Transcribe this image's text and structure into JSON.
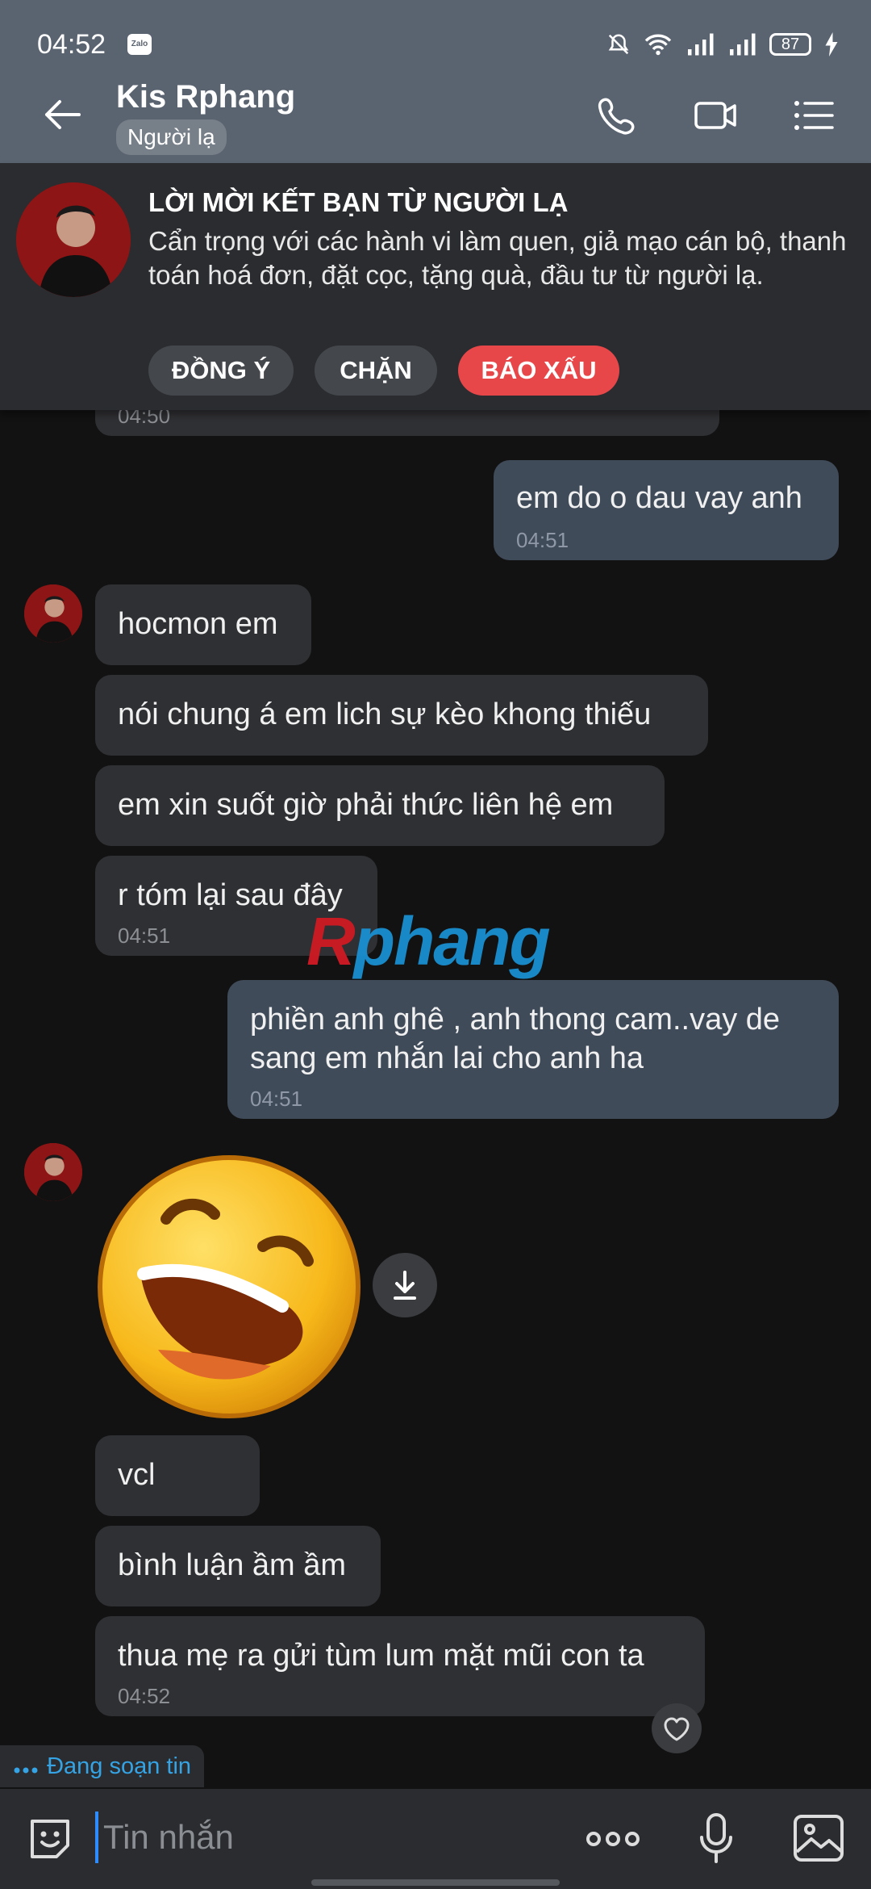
{
  "status": {
    "time": "04:52",
    "app_badge": "Zalo",
    "battery": "87"
  },
  "header": {
    "name": "Kis Rphang",
    "tag": "Người lạ"
  },
  "request": {
    "title": "LỜI MỜI KẾT BẠN TỪ NGƯỜI LẠ",
    "body": "Cẩn trọng với các hành vi làm quen, giả mạo cán bộ, thanh toán hoá đơn, đặt cọc, tặng quà, đầu tư từ người lạ.",
    "accept": "ĐỒNG Ý",
    "block": "CHẶN",
    "report": "BÁO XẤU"
  },
  "messages": {
    "m0_time": "04:50",
    "m1": {
      "text": "em do o dau vay anh",
      "time": "04:51"
    },
    "m2": "hocmon em",
    "m3": "nói chung á em lich sự kèo khong thiếu",
    "m4": "em xin suốt giờ phải thức liên hệ em",
    "m5": {
      "text": "r tóm lại sau đây",
      "time": "04:51"
    },
    "m6": {
      "line1": "phiền anh ghê , anh thong cam..vay de",
      "line2": "sang em nhắn lai cho anh ha",
      "time": "04:51"
    },
    "m7": "vcl",
    "m8": "bình luận ầm ầm",
    "m9": {
      "text": "thua mẹ ra gửi tùm lum mặt mũi con ta",
      "time": "04:52"
    }
  },
  "watermark": {
    "first": "R",
    "rest": "phang"
  },
  "typing": "Đang soạn tin",
  "input": {
    "placeholder": "Tin nhắn"
  },
  "colors": {
    "header": "#5a6370",
    "sent_bubble": "#404b5a",
    "received_bubble": "#2f3033",
    "report": "#e8474a",
    "accent": "#35a3e4"
  }
}
